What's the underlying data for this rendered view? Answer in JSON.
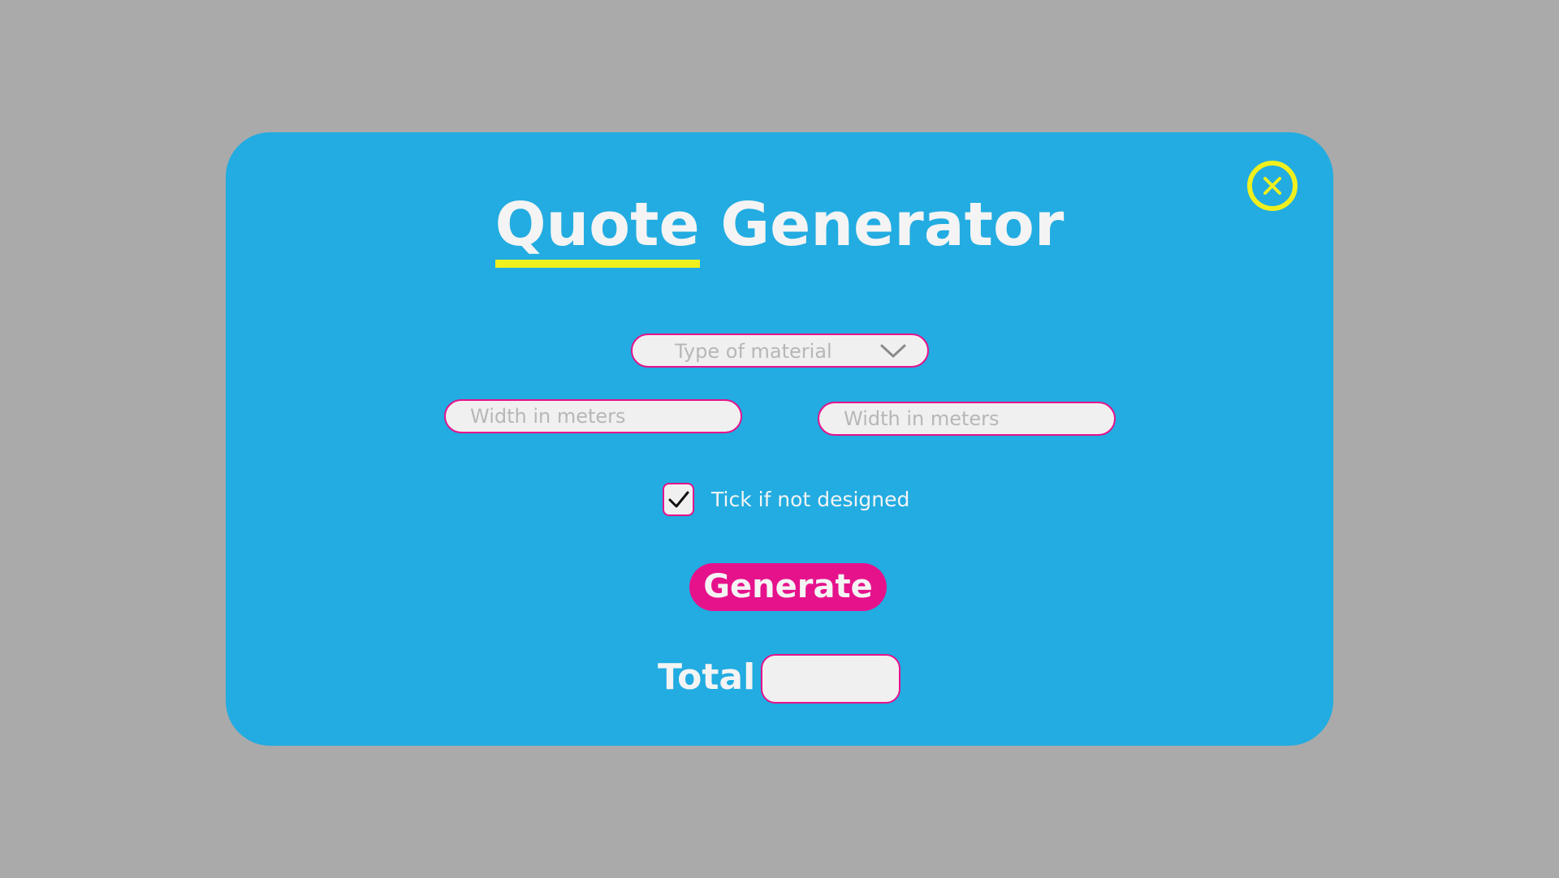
{
  "quote_form": {
    "title_first_word": "Quote",
    "title_second_word": "Generator",
    "material_select": {
      "selected_value": "Type of material",
      "icon": "chevron-down-icon"
    },
    "width_input_1": {
      "value": "",
      "placeholder": "Width in meters"
    },
    "width_input_2": {
      "value": "",
      "placeholder": "Width in meters"
    },
    "not_designed_checkbox": {
      "checked": true,
      "label": "Tick if not designed"
    },
    "generate_label": "Generate",
    "total_label": "Total",
    "total_value": "",
    "close_icon": "close-circle-icon"
  },
  "colors": {
    "background": "#aaaaaa",
    "modal": "#22ace1",
    "accent_yellow": "#f0f01e",
    "accent_pink": "#e6128c",
    "field_fill": "#f0f0f0",
    "text_light": "#f4f4f4",
    "placeholder": "#b7b7b7"
  }
}
